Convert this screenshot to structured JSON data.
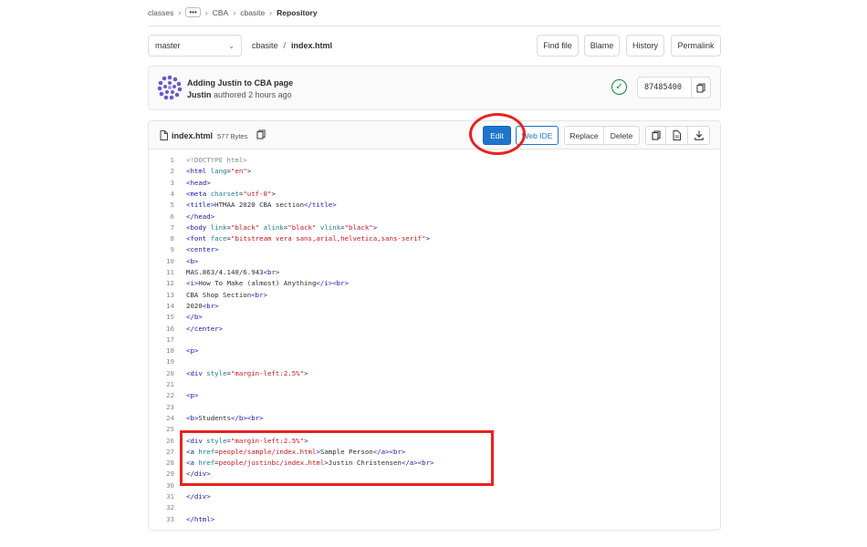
{
  "breadcrumb": {
    "items": [
      "classes",
      "CBA",
      "cbasite"
    ],
    "ellipsis": "•••",
    "current": "Repository"
  },
  "toolbar": {
    "branch": "master",
    "path_root": "cbasite",
    "path_sep": "/",
    "path_file": "index.html",
    "find_file": "Find file",
    "blame": "Blame",
    "history": "History",
    "permalink": "Permalink"
  },
  "commit": {
    "title": "Adding Justin to CBA page",
    "author": "Justin",
    "authored": "authored",
    "time": "2 hours ago",
    "sha": "87485400",
    "status": "success"
  },
  "file": {
    "name": "index.html",
    "size": "577 Bytes",
    "edit": "Edit",
    "web_ide": "Web IDE",
    "replace": "Replace",
    "delete": "Delete"
  },
  "code_lines": [
    "<!DOCTYPE html>",
    "<html lang=\"en\">",
    "<head>",
    "<meta charset=\"utf-8\">",
    "<title>HTMAA 2020 CBA section</title>",
    "</head>",
    "<body link=\"black\" alink=\"black\" vlink=\"black\">",
    "<font face=\"bitstream vera sans,arial,helvetica,sans-serif\">",
    "<center>",
    "<b>",
    "MAS.863/4.140/6.943<br>",
    "<i>How To Make (almost) Anything</i><br>",
    "CBA Shop Section<br>",
    "2020<br>",
    "</b>",
    "</center>",
    "",
    "<p>",
    "",
    "<div style=\"margin-left:2.5%\">",
    "",
    "<p>",
    "",
    "<b>Students</b><br>",
    "",
    "<div style=\"margin-left:2.5%\">",
    "<a href=people/sample/index.html>Sample Person</a><br>",
    "<a href=people/justinbc/index.html>Justin Christensen</a><br>",
    "</div>",
    "",
    "</div>",
    "",
    "</html>"
  ],
  "colors": {
    "primary": "#1f75cb",
    "success": "#108548",
    "annotation": "#e8231e"
  }
}
